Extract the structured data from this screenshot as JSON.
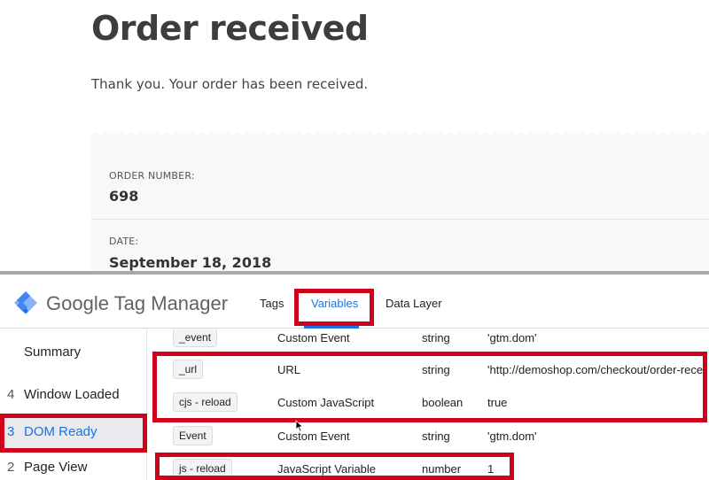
{
  "shop": {
    "title": "Order received",
    "thanks": "Thank you. Your order has been received.",
    "order_number_label": "ORDER NUMBER:",
    "order_number": "698",
    "date_label": "DATE:",
    "date": "September 18, 2018"
  },
  "gtm": {
    "brand": "Google Tag Manager",
    "tabs": [
      {
        "label": "Tags",
        "active": false
      },
      {
        "label": "Variables",
        "active": true
      },
      {
        "label": "Data Layer",
        "active": false
      }
    ],
    "sidebar": [
      {
        "num": "",
        "label": "Summary",
        "active": false
      },
      {
        "num": "4",
        "label": "Window Loaded",
        "active": false
      },
      {
        "num": "3",
        "label": "DOM Ready",
        "active": true
      },
      {
        "num": "2",
        "label": "Page View",
        "active": false
      }
    ],
    "variables": [
      {
        "name": "_event",
        "type": "Custom Event",
        "return_type": "string",
        "value": "'gtm.dom'"
      },
      {
        "name": "_url",
        "type": "URL",
        "return_type": "string",
        "value": "'http://demoshop.com/checkout/order-rece"
      },
      {
        "name": "cjs - reload",
        "type": "Custom JavaScript",
        "return_type": "boolean",
        "value": "true"
      },
      {
        "name": "Event",
        "type": "Custom Event",
        "return_type": "string",
        "value": "'gtm.dom'"
      },
      {
        "name": "js - reload",
        "type": "JavaScript Variable",
        "return_type": "number",
        "value": "1"
      }
    ]
  },
  "colors": {
    "highlight": "#d0021b",
    "accent": "#1a73e8",
    "gtm_logo_light": "#8ab4f8",
    "gtm_logo_dark": "#4285f4"
  },
  "icons": {
    "gtm_logo": "gtm-logo-icon",
    "cursor": "mouse-cursor-icon"
  }
}
